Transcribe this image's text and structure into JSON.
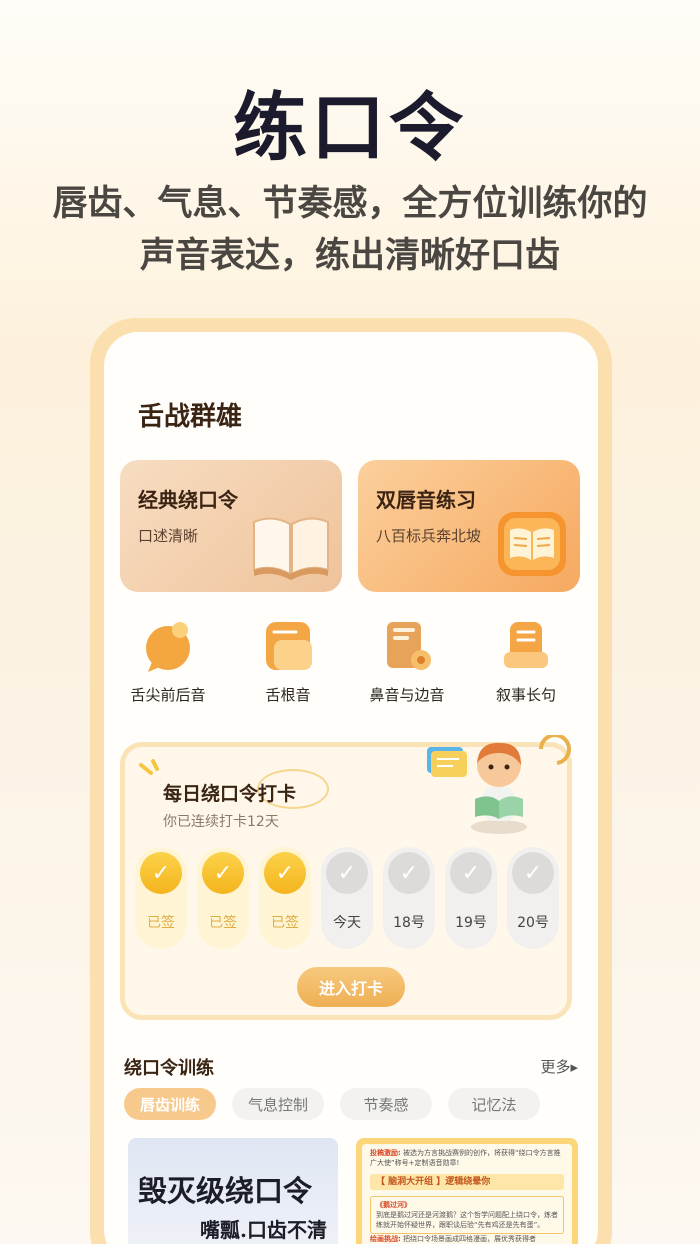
{
  "hero": {
    "title": "练口令",
    "subtitle_line1": "唇齿、气息、节奏感，全方位训练你的",
    "subtitle_line2": "声音表达，练出清晰好口齿"
  },
  "section_title": "舌战群雄",
  "cards": [
    {
      "title": "经典绕口令",
      "subtitle": "口述清晰",
      "icon": "open-book-icon"
    },
    {
      "title": "双唇音练习",
      "subtitle": "八百标兵奔北坡",
      "icon": "book-badge-icon"
    }
  ],
  "categories": [
    {
      "label": "舌尖前后音",
      "icon": "speech-bubble-icon"
    },
    {
      "label": "舌根音",
      "icon": "notes-icon"
    },
    {
      "label": "鼻音与边音",
      "icon": "clipboard-icon"
    },
    {
      "label": "叙事长句",
      "icon": "document-stack-icon"
    }
  ],
  "checkin": {
    "title": "每日绕口令打卡",
    "subtitle": "你已连续打卡12天",
    "days": [
      {
        "label": "已签",
        "done": true
      },
      {
        "label": "已签",
        "done": true
      },
      {
        "label": "已签",
        "done": true
      },
      {
        "label": "今天",
        "done": false
      },
      {
        "label": "18号",
        "done": false
      },
      {
        "label": "19号",
        "done": false
      },
      {
        "label": "20号",
        "done": false
      }
    ],
    "check_glyph": "✓",
    "button": "进入打卡"
  },
  "training": {
    "title": "绕口令训练",
    "more": "更多▸",
    "tabs": [
      "唇齿训练",
      "气息控制",
      "节奏感",
      "记忆法"
    ],
    "active_tab": 0,
    "thumb1_line1": "毁灭级绕口令",
    "thumb1_line2": "嘴瓢.口齿不清",
    "thumb2_label1": "投稿激励:",
    "thumb2_text1": "被选为方言挑战赛例的创作，将获得“绕口令方言推广大使”称号+定制语音勋章!",
    "thumb2_banner": "【 脑洞大开组 】逻辑绕晕你",
    "thumb2_quote": "《鹅过河》",
    "thumb2_text2": "到底是鹅过河还是河渡鹅？这个哲学问题配上绕口令，炼者练就开始怀疑世界，跟职谈后验“先有鸡还是先有蛋”。",
    "thumb2_label3": "绘画挑战:",
    "thumb2_text3": "把绕口令场景画成四格漫画，展优秀获得者"
  },
  "colors": {
    "accent": "#f4b41d",
    "frame": "#fbdfae",
    "title": "#1c1b2e"
  }
}
